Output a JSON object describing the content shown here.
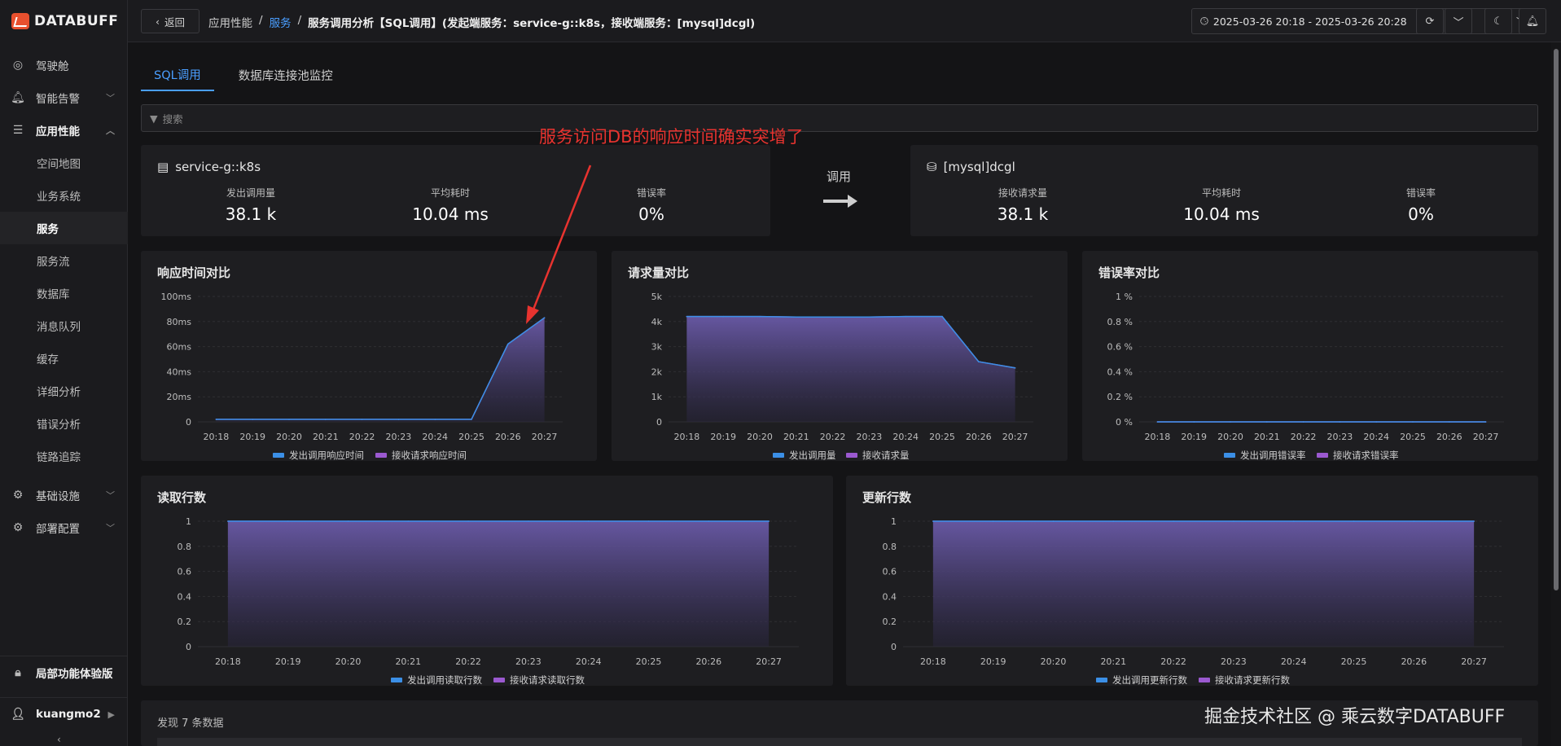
{
  "app": {
    "logo": "DATABUFF",
    "watermark": "掘金技术社区 @ 乘云数字DATABUFF"
  },
  "sidebar": {
    "items": [
      {
        "label": "驾驶舱",
        "icon": "dashboard-icon"
      },
      {
        "label": "智能告警",
        "icon": "bell-icon"
      },
      {
        "label": "应用性能",
        "icon": "apm-icon"
      }
    ],
    "sub_items": [
      "空间地图",
      "业务系统",
      "服务",
      "服务流",
      "数据库",
      "消息队列",
      "缓存",
      "详细分析",
      "错误分析",
      "链路追踪"
    ],
    "items_after": [
      {
        "label": "基础设施",
        "icon": "infra-icon"
      },
      {
        "label": "部署配置",
        "icon": "gear-icon"
      }
    ],
    "trial": "局部功能体验版",
    "user": "kuangmo2"
  },
  "topbar": {
    "back": "返回",
    "crumbs": [
      "应用性能",
      "/",
      "服务",
      "/",
      "服务调用分析【SQL调用】(发起端服务：service-g::k8s，接收端服务：[mysql]dcgl)"
    ],
    "time_range": "2025-03-26 20:18 - 2025-03-26 20:28"
  },
  "tabs": [
    "SQL调用",
    "数据库连接池监控"
  ],
  "search": {
    "placeholder": "搜索"
  },
  "annotation": "服务访问DB的响应时间确实突增了",
  "caller": {
    "name": "service-g::k8s",
    "metrics": [
      {
        "label": "发出调用量",
        "value": "38.1 k"
      },
      {
        "label": "平均耗时",
        "value": "10.04 ms"
      },
      {
        "label": "错误率",
        "value": "0%"
      }
    ]
  },
  "call_label": "调用",
  "callee": {
    "name": "[mysql]dcgl",
    "metrics": [
      {
        "label": "接收请求量",
        "value": "38.1 k"
      },
      {
        "label": "平均耗时",
        "value": "10.04 ms"
      },
      {
        "label": "错误率",
        "value": "0%"
      }
    ]
  },
  "chart_data": [
    {
      "type": "area",
      "title": "响应时间对比",
      "x": [
        "20:18",
        "20:19",
        "20:20",
        "20:21",
        "20:22",
        "20:23",
        "20:24",
        "20:25",
        "20:26",
        "20:27"
      ],
      "yticks": [
        "0",
        "20ms",
        "40ms",
        "60ms",
        "80ms",
        "100ms"
      ],
      "ylim": [
        0,
        100
      ],
      "series": [
        {
          "name": "发出调用响应时间",
          "color": "#3b8fe6",
          "values": [
            2,
            2,
            2,
            2,
            2,
            2,
            2,
            2,
            62,
            83
          ]
        },
        {
          "name": "接收请求响应时间",
          "color": "#9b59d0",
          "values": [
            2,
            2,
            2,
            2,
            2,
            2,
            2,
            2,
            62,
            83
          ]
        }
      ]
    },
    {
      "type": "area",
      "title": "请求量对比",
      "x": [
        "20:18",
        "20:19",
        "20:20",
        "20:21",
        "20:22",
        "20:23",
        "20:24",
        "20:25",
        "20:26",
        "20:27"
      ],
      "yticks": [
        "0",
        "1k",
        "2k",
        "3k",
        "4k",
        "5k"
      ],
      "ylim": [
        0,
        5000
      ],
      "series": [
        {
          "name": "发出调用量",
          "color": "#3b8fe6",
          "values": [
            4200,
            4200,
            4200,
            4180,
            4180,
            4180,
            4200,
            4200,
            2400,
            2150
          ]
        },
        {
          "name": "接收请求量",
          "color": "#9b59d0",
          "values": [
            4200,
            4200,
            4200,
            4180,
            4180,
            4180,
            4200,
            4200,
            2400,
            2150
          ]
        }
      ]
    },
    {
      "type": "area",
      "title": "错误率对比",
      "x": [
        "20:18",
        "20:19",
        "20:20",
        "20:21",
        "20:22",
        "20:23",
        "20:24",
        "20:25",
        "20:26",
        "20:27"
      ],
      "yticks": [
        "0 %",
        "0.2 %",
        "0.4 %",
        "0.6 %",
        "0.8 %",
        "1 %"
      ],
      "ylim": [
        0,
        1
      ],
      "series": [
        {
          "name": "发出调用错误率",
          "color": "#3b8fe6",
          "values": [
            0,
            0,
            0,
            0,
            0,
            0,
            0,
            0,
            0,
            0
          ]
        },
        {
          "name": "接收请求错误率",
          "color": "#9b59d0",
          "values": [
            0,
            0,
            0,
            0,
            0,
            0,
            0,
            0,
            0,
            0
          ]
        }
      ]
    },
    {
      "type": "area",
      "title": "读取行数",
      "x": [
        "20:18",
        "20:19",
        "20:20",
        "20:21",
        "20:22",
        "20:23",
        "20:24",
        "20:25",
        "20:26",
        "20:27"
      ],
      "yticks": [
        "0",
        "0.2",
        "0.4",
        "0.6",
        "0.8",
        "1"
      ],
      "ylim": [
        0,
        1
      ],
      "series": [
        {
          "name": "发出调用读取行数",
          "color": "#3b8fe6",
          "values": [
            1,
            1,
            1,
            1,
            1,
            1,
            1,
            1,
            1,
            1
          ]
        },
        {
          "name": "接收请求读取行数",
          "color": "#9b59d0",
          "values": [
            1,
            1,
            1,
            1,
            1,
            1,
            1,
            1,
            1,
            1
          ]
        }
      ]
    },
    {
      "type": "area",
      "title": "更新行数",
      "x": [
        "20:18",
        "20:19",
        "20:20",
        "20:21",
        "20:22",
        "20:23",
        "20:24",
        "20:25",
        "20:26",
        "20:27"
      ],
      "yticks": [
        "0",
        "0.2",
        "0.4",
        "0.6",
        "0.8",
        "1"
      ],
      "ylim": [
        0,
        1
      ],
      "series": [
        {
          "name": "发出调用更新行数",
          "color": "#3b8fe6",
          "values": [
            1,
            1,
            1,
            1,
            1,
            1,
            1,
            1,
            1,
            1
          ]
        },
        {
          "name": "接收请求更新行数",
          "color": "#9b59d0",
          "values": [
            1,
            1,
            1,
            1,
            1,
            1,
            1,
            1,
            1,
            1
          ]
        }
      ]
    }
  ],
  "footer": {
    "found": "发现 7 条数据"
  }
}
